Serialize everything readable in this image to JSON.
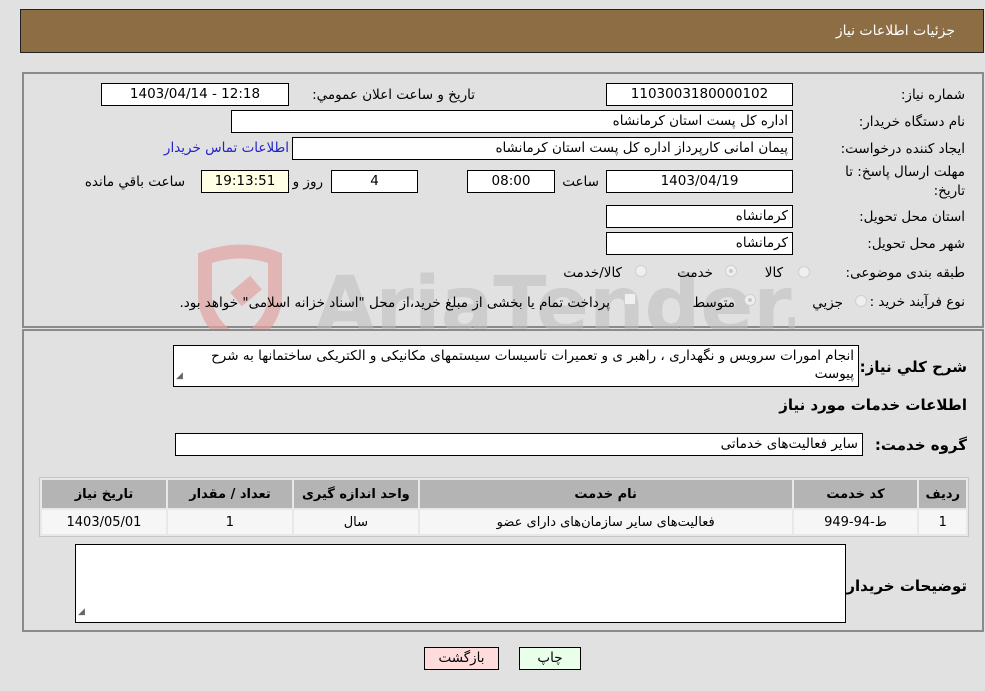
{
  "header": {
    "title": "جزئیات اطلاعات نیاز"
  },
  "form": {
    "need_number": {
      "label": "شماره نیاز:",
      "value": "1103003180000102"
    },
    "announce_datetime": {
      "label": "تاریخ و ساعت اعلان عمومي:",
      "value": "1403/04/14 - 12:18"
    },
    "buyer_org": {
      "label": "نام دستگاه خریدار:",
      "value": "اداره کل پست استان کرمانشاه"
    },
    "requester": {
      "label": "ایجاد کننده درخواست:",
      "value": "پیمان امانی کارپرداز اداره کل پست استان کرمانشاه"
    },
    "buyer_contact_link": "اطلاعات تماس خریدار",
    "deadline": {
      "label_line1": "مهلت ارسال پاسخ: تا",
      "label_line2": "تاریخ:",
      "date": "1403/04/19",
      "time_label": "ساعت",
      "time": "08:00",
      "days": "4",
      "days_label": "روز و",
      "remaining_time": "19:13:51",
      "remaining_label": "ساعت باقي مانده"
    },
    "delivery_province": {
      "label": "استان محل تحویل:",
      "value": "کرمانشاه"
    },
    "delivery_city": {
      "label": "شهر محل تحویل:",
      "value": "کرمانشاه"
    },
    "category": {
      "label": "طبقه بندی موضوعی:",
      "options": [
        "کالا",
        "خدمت",
        "کالا/خدمت"
      ],
      "selected": "خدمت"
    },
    "purchase_process": {
      "label": "نوع فرآیند خرید :",
      "options": [
        "جزیي",
        "متوسط"
      ],
      "selected": "متوسط",
      "treasury_note": "پرداخت تمام یا بخشی از مبلغ خرید،از محل \"اسناد خزانه اسلامی\" خواهد بود."
    }
  },
  "description": {
    "label": "شرح کلي نیاز:",
    "value": "انجام امورات سرویس و نگهداری ، راهبر ی و تعمیرات تاسیسات سیستمهای مکانیکی و الکتریکی ساختمانها به شرح پیوست"
  },
  "services": {
    "section_title": "اطلاعات خدمات مورد نیاز",
    "group_label": "گروه خدمت:",
    "group_value": "سایر فعالیت‌های خدماتی",
    "columns": [
      "ردیف",
      "کد خدمت",
      "نام خدمت",
      "واحد اندازه گیری",
      "تعداد / مقدار",
      "تاریخ نیاز"
    ],
    "rows": [
      [
        "1",
        "ط-94-949",
        "فعالیت‌های سایر سازمان‌های دارای عضو",
        "سال",
        "1",
        "1403/05/01"
      ]
    ]
  },
  "buyer_notes": {
    "label": "توضیحات خریدار:",
    "value": ""
  },
  "buttons": {
    "print": "چاپ",
    "back": "بازگشت"
  },
  "colors": {
    "header_bg": "#8c6d44",
    "print_bg": "#eaffea",
    "back_bg": "#ffdcdc",
    "link": "#2323c8"
  },
  "watermark": {
    "text": "AriaTender.neT"
  }
}
